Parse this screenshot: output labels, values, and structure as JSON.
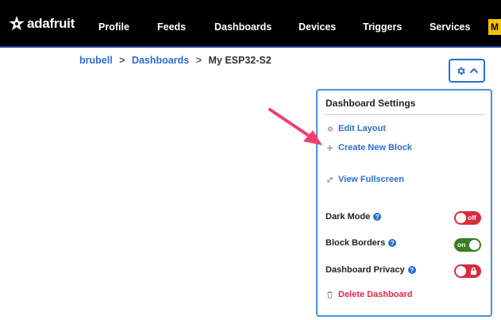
{
  "nav": {
    "logo_text": "adafruit",
    "items": [
      "Profile",
      "Feeds",
      "Dashboards",
      "Devices",
      "Triggers",
      "Services"
    ],
    "partial_item": "M"
  },
  "breadcrumb": {
    "user": "brubell",
    "separator": ">",
    "section": "Dashboards",
    "current": "My ESP32-S2"
  },
  "settings_button": {
    "icons": [
      "gear-icon",
      "chevron-up-icon"
    ]
  },
  "panel": {
    "title": "Dashboard Settings",
    "actions": {
      "edit_layout": "Edit Layout",
      "create_block": "Create New Block",
      "view_fullscreen": "View Fullscreen",
      "delete_dashboard": "Delete Dashboard"
    },
    "settings": {
      "dark_mode": {
        "label": "Dark Mode",
        "state_text": "off"
      },
      "block_borders": {
        "label": "Block Borders",
        "state_text": "on"
      },
      "privacy": {
        "label": "Dashboard Privacy",
        "icon": "lock-icon"
      }
    }
  },
  "colors": {
    "accent": "#2a6ecf",
    "nav_bg": "#000000",
    "danger": "#e2264a",
    "toggle_off": "#d92b3d",
    "toggle_on": "#3a7d1e",
    "annotation_arrow": "#ee3f6f"
  }
}
